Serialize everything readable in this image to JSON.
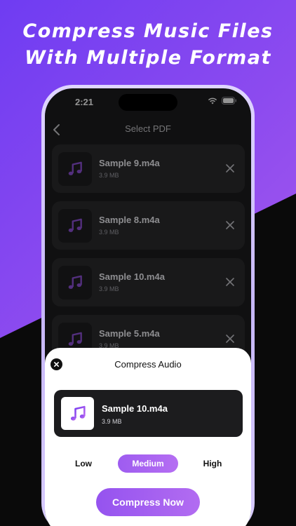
{
  "headline": {
    "line1": "Compress Music Files",
    "line2": "With Multiple Format"
  },
  "status_bar": {
    "time": "2:21"
  },
  "nav": {
    "title": "Select PDF"
  },
  "files": [
    {
      "name": "Sample 9.m4a",
      "size": "3.9 MB"
    },
    {
      "name": "Sample 8.m4a",
      "size": "3.9 MB"
    },
    {
      "name": "Sample 10.m4a",
      "size": "3.9 MB"
    },
    {
      "name": "Sample 5.m4a",
      "size": "3.9 MB"
    }
  ],
  "sheet": {
    "title": "Compress Audio",
    "selected_file": {
      "name": "Sample 10.m4a",
      "size": "3.9 MB"
    },
    "quality_options": [
      "Low",
      "Medium",
      "High"
    ],
    "selected_quality": "Medium",
    "cta_label": "Compress Now"
  },
  "colors": {
    "accent": "#a15ff0",
    "screen_bg": "#1c1c1e",
    "card_bg": "#2c2c2e"
  },
  "icons": {
    "file": "music-note-icon",
    "remove": "close-icon",
    "back": "chevron-left-icon"
  }
}
